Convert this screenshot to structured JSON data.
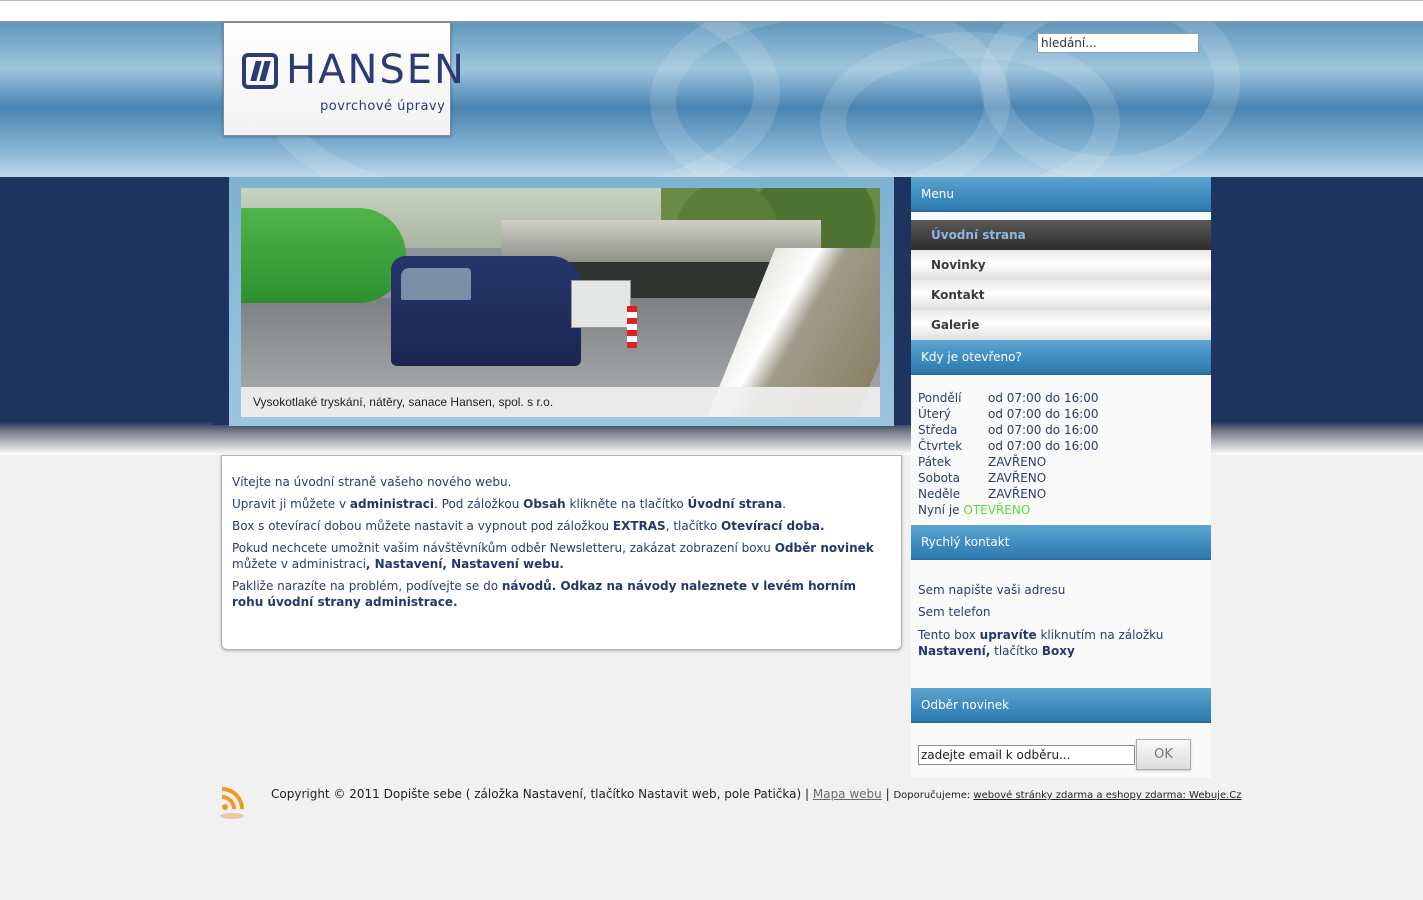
{
  "header": {
    "logo_text": "HANSEN",
    "logo_sub": "povrchové úpravy",
    "search_value": "hledání..."
  },
  "slide": {
    "caption": "Vysokotlaké tryskání, nátěry, sanace Hansen, spol. s r.o."
  },
  "content": {
    "p1": "Vítejte na úvodní straně vašeho nového webu.",
    "p2_a": "Upravit ji můžete v ",
    "p2_b": "administraci",
    "p2_c": ". Pod záložkou ",
    "p2_d": "Obsah",
    "p2_e": " klikněte na tlačítko ",
    "p2_f": "Úvodní strana",
    "p2_g": ".",
    "p3_a": "Box s otevírací dobou můžete nastavit a vypnout pod záložkou ",
    "p3_b": "EXTRAS",
    "p3_c": ", tlačítko ",
    "p3_d": "Otevírací doba.",
    "p4_a": "Pokud nechcete umožnit vašim návštěvníkům odběr Newsletteru, zakázat zobrazení boxu ",
    "p4_b": "Odběr novinek",
    "p4_c": " můžete v administraci",
    "p4_d": ", Nastavení, Nastavení webu.",
    "p5_a": "Pakliže narazíte na problém, podívejte se do ",
    "p5_b": "návodů. Odkaz na návody naleznete v levém horním rohu úvodní strany administrace."
  },
  "sidebar": {
    "menu_title": "Menu",
    "menu_items": [
      "Úvodní strana",
      "Novinky",
      "Kontakt",
      "Galerie"
    ],
    "hours_title": "Kdy je otevřeno?",
    "hours": [
      {
        "day": "Pondělí",
        "time": "od 07:00 do 16:00"
      },
      {
        "day": "Úterý",
        "time": "od 07:00 do 16:00"
      },
      {
        "day": "Středa",
        "time": "od 07:00 do 16:00"
      },
      {
        "day": "Čtvrtek",
        "time": "od 07:00 do 16:00"
      },
      {
        "day": "Pátek",
        "time": "ZAVŘENO"
      },
      {
        "day": "Sobota",
        "time": "ZAVŘENO"
      },
      {
        "day": "Neděle",
        "time": "ZAVŘENO"
      }
    ],
    "now_label": "Nyní je ",
    "now_status": "OTEVŘENO",
    "contact_title": "Rychlý kontakt",
    "contact_address": "Sem napište vaši adresu",
    "contact_phone": "Sem telefon",
    "contact_note_a": "Tento box ",
    "contact_note_b": "upravíte",
    "contact_note_c": " kliknutím na záložku ",
    "contact_note_d": "Nastavení,",
    "contact_note_e": " tlačítko ",
    "contact_note_f": "Boxy",
    "newsletter_title": "Odběr novinek",
    "email_value": "zadejte email k odběru...",
    "ok_label": "OK"
  },
  "footer": {
    "copyright": "Copyright © 2011 Dopište sebe ( záložka Nastavení, tlačítko Nastavit web, pole Patička) | ",
    "sitemap": "Mapa webu",
    "sep": " | ",
    "recommend": "Doporučujeme: ",
    "webuje": "webové stránky zdarma a eshopy zdarma: Webuje.Cz"
  },
  "colors": {
    "navy": "#1f3360",
    "accent_blue": "#3f8cc0",
    "open_green": "#5fd83b",
    "text": "#2b3d6e"
  },
  "icons": [
    "rss-icon"
  ]
}
